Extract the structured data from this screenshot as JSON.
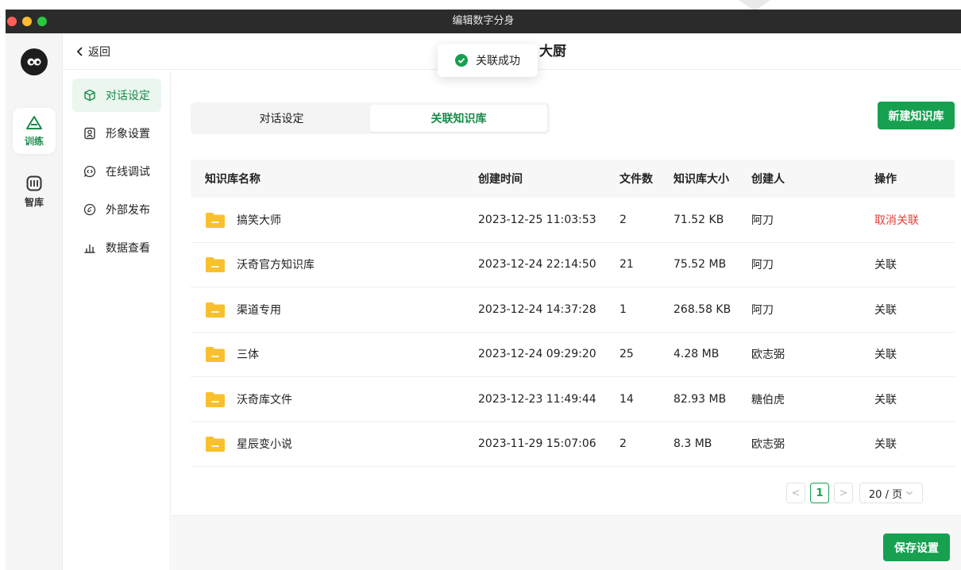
{
  "window": {
    "title": "编辑数字分身"
  },
  "rail": {
    "items": [
      {
        "label": "训练",
        "icon": "triangle-icon",
        "active": true
      },
      {
        "label": "智库",
        "icon": "book-icon",
        "active": false
      }
    ]
  },
  "header": {
    "back_label": "返回",
    "title": "大厨"
  },
  "toast": {
    "message": "关联成功",
    "icon": "check-circle-icon"
  },
  "submenu": {
    "items": [
      {
        "label": "对话设定",
        "icon": "cube-icon",
        "active": true
      },
      {
        "label": "形象设置",
        "icon": "portrait-icon",
        "active": false
      },
      {
        "label": "在线调试",
        "icon": "code-bubble-icon",
        "active": false
      },
      {
        "label": "外部发布",
        "icon": "publish-icon",
        "active": false
      },
      {
        "label": "数据查看",
        "icon": "bar-chart-icon",
        "active": false
      }
    ]
  },
  "tabs": [
    {
      "label": "对话设定",
      "active": false
    },
    {
      "label": "关联知识库",
      "active": true
    }
  ],
  "new_button": "新建知识库",
  "table": {
    "columns": [
      "知识库名称",
      "创建时间",
      "文件数",
      "知识库大小",
      "创建人",
      "操作"
    ],
    "rows": [
      {
        "name": "搞笑大师",
        "created": "2023-12-25 11:03:53",
        "files": "2",
        "size": "71.52 KB",
        "creator": "阿刀",
        "action": "取消关联",
        "linked": true
      },
      {
        "name": "沃奇官方知识库",
        "created": "2023-12-24 22:14:50",
        "files": "21",
        "size": "75.52 MB",
        "creator": "阿刀",
        "action": "关联",
        "linked": false
      },
      {
        "name": "渠道专用",
        "created": "2023-12-24 14:37:28",
        "files": "1",
        "size": "268.58 KB",
        "creator": "阿刀",
        "action": "关联",
        "linked": false
      },
      {
        "name": "三体",
        "created": "2023-12-24 09:29:20",
        "files": "25",
        "size": "4.28 MB",
        "creator": "欧志弼",
        "action": "关联",
        "linked": false
      },
      {
        "name": "沃奇库文件",
        "created": "2023-12-23 11:49:44",
        "files": "14",
        "size": "82.93 MB",
        "creator": "糖伯虎",
        "action": "关联",
        "linked": false
      },
      {
        "name": "星辰变小说",
        "created": "2023-11-29 15:07:06",
        "files": "2",
        "size": "8.3 MB",
        "creator": "欧志弼",
        "action": "关联",
        "linked": false
      }
    ]
  },
  "pagination": {
    "prev": "<",
    "current": "1",
    "next": ">",
    "page_size": "20 / 页"
  },
  "footer": {
    "save_label": "保存设置"
  },
  "colors": {
    "accent": "#16a050",
    "danger": "#e0413a",
    "folder": "#f7c02c"
  }
}
